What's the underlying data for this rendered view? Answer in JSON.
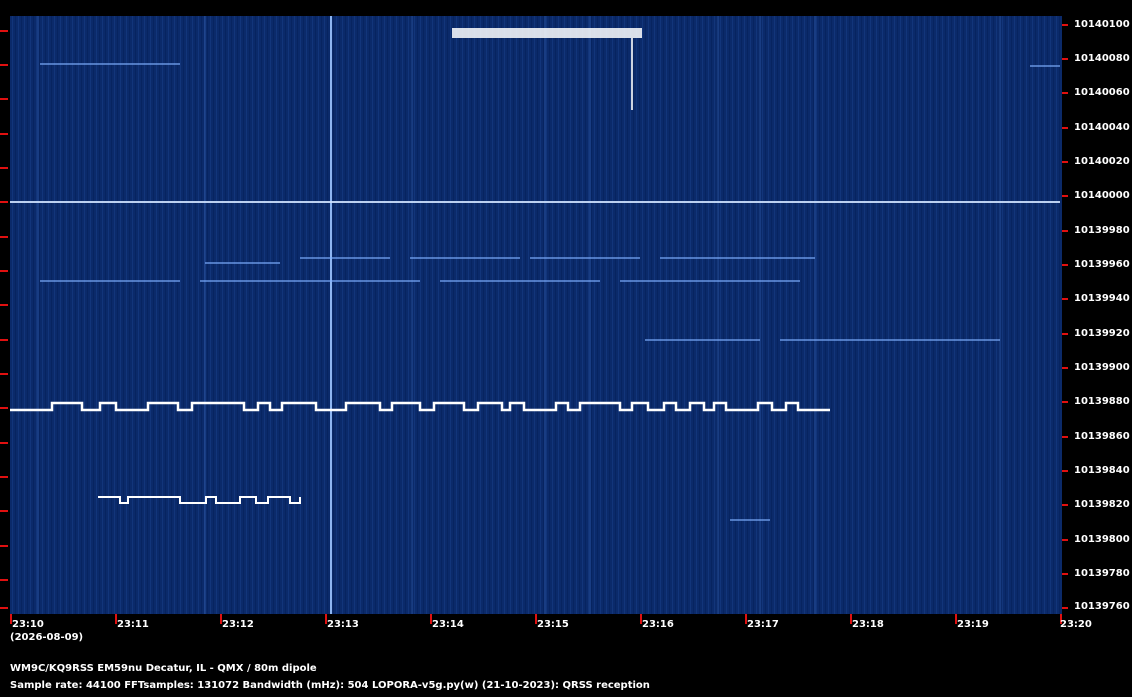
{
  "frequency_labels": [
    "10140100",
    "10140080",
    "10140060",
    "10140040",
    "10140020",
    "10140000",
    "10139980",
    "10139960",
    "10139940",
    "10139920",
    "10139900",
    "10139880",
    "10139860",
    "10139840",
    "10139820",
    "10139800",
    "10139780",
    "10139760"
  ],
  "time_labels": [
    "23:10",
    "23:11",
    "23:12",
    "23:13",
    "23:14",
    "23:15",
    "23:16",
    "23:17",
    "23:18",
    "23:19",
    "23:20"
  ],
  "date": "(2026-08-09)",
  "station": "WM9C/KQ9RSS EM59nu Decatur, IL - QMX / 80m dipole",
  "info": "Sample rate: 44100    FFTsamples: 131072    Bandwidth (mHz): 504",
  "software": "LOPORA-v5g.py(w) (21-10-2023): QRSS reception",
  "colors": {
    "background": "#000000",
    "plot": "#0b2a6a",
    "tick": "#e01010",
    "signal": "#ffffff",
    "faint_signal": "#7fb0ff"
  }
}
